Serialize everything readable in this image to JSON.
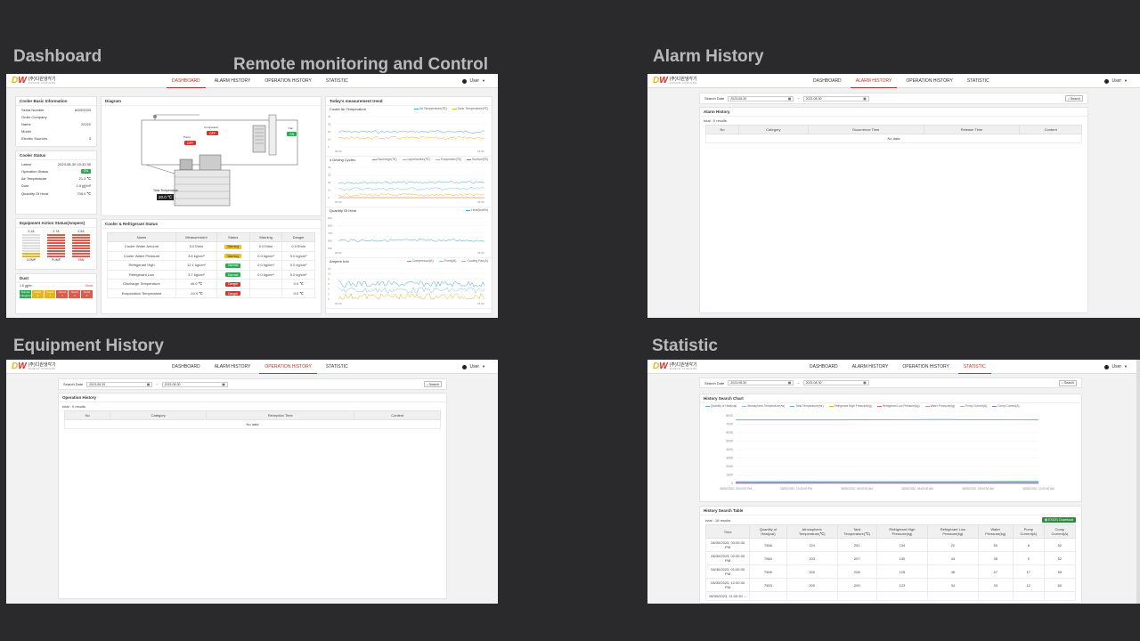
{
  "sections": {
    "dashboard": "Dashboard",
    "remote": "Remote monitoring and Control",
    "alarm": "Alarm History",
    "equipment": "Equipment History",
    "statistic": "Statistic"
  },
  "nav": [
    "DASHBOARD",
    "ALARM HISTORY",
    "OPERATION HISTORY",
    "STATISTIC"
  ],
  "user_label": "User",
  "logo": {
    "mark": "DW",
    "ko": "(주)디원냉각기",
    "en": "DAWON COOLERS"
  },
  "dashboard": {
    "basic_info": {
      "title": "Cooler Basic Information",
      "rows": [
        {
          "label": "Serial Number",
          "value": "A0022033"
        },
        {
          "label": "Order Company",
          "value": ""
        },
        {
          "label": "Name",
          "value": "22222"
        },
        {
          "label": "Model",
          "value": ""
        },
        {
          "label": "Electric Sources",
          "value": "3"
        }
      ]
    },
    "status": {
      "title": "Cooler Status",
      "rows": [
        {
          "label": "Latest",
          "value": "2023-08-30 15:32:30"
        },
        {
          "label": "Operation Status",
          "value": "ON"
        },
        {
          "label": "Air Temperature",
          "value": "21.3 ℃"
        },
        {
          "label": "Dust",
          "value": "1.5 ㎍/m³"
        },
        {
          "label": "Quantity Of Heat",
          "value": "700.0 ℃"
        }
      ]
    },
    "equipment_action": {
      "title": "Equipment Action Status(Ampere)",
      "items": [
        {
          "amp": "0.1A",
          "name": "COMP",
          "level": 0.25,
          "color": "#e8b41c"
        },
        {
          "amp": "2.7A",
          "name": "PUMP",
          "level": 1.0,
          "color": "#e05a4b"
        },
        {
          "amp": "0.9A",
          "name": "FAN",
          "level": 1.0,
          "color": "#e05a4b"
        }
      ]
    },
    "dust": {
      "title": "Dust",
      "value": "1.5 ㎍/m³",
      "label": "Good",
      "levels": [
        {
          "name": "Normal",
          "sub": "1.5ug/m3",
          "color": "#2fa84f"
        },
        {
          "name": "Good",
          "sub": "1",
          "color": "#e8b41c"
        },
        {
          "name": "Good",
          "sub": "1",
          "color": "#e8b41c"
        },
        {
          "name": "Good",
          "sub": "1",
          "color": "#e05a4b"
        },
        {
          "name": "Good",
          "sub": "3",
          "color": "#e05a4b"
        },
        {
          "name": "Good",
          "sub": "4",
          "color": "#e05a4b"
        }
      ]
    },
    "diagram": {
      "title": "Diagram",
      "compressor": "Compressor",
      "compressor_state": "OFF",
      "pump": "Pump",
      "pump_state": "OFF",
      "fan": "Fan",
      "fan_state": "ON",
      "tank_label": "Tank Temperature",
      "tank_value": "20.0 ℃"
    },
    "refrigerant": {
      "title": "Cooler & Refrigerant Status",
      "headers": [
        "Name",
        "Measurement",
        "Status",
        "Warning",
        "Danger"
      ],
      "rows": [
        {
          "name": "Cooler Water Amount",
          "meas": "5.0 ℓ/min",
          "status": "Warning",
          "color": "#f0c419",
          "warn": "0.0 ℓ/min",
          "danger": "0.0 ℓ/min"
        },
        {
          "name": "Cooler Water Pressure",
          "meas": "3.6 kg/cm²",
          "status": "Warning",
          "color": "#f0c419",
          "warn": "0.0 kg/cm²",
          "danger": "0.0 kg/cm²"
        },
        {
          "name": "Refrigerant High",
          "meas": "12.1 kg/cm²",
          "status": "Normal",
          "color": "#2fa84f",
          "warn": "0.0 kg/cm²",
          "danger": "0.0 kg/cm²"
        },
        {
          "name": "Refrigerant Low",
          "meas": "3.7 kg/cm²",
          "status": "Normal",
          "color": "#2fa84f",
          "warn": "0.0 kg/cm²",
          "danger": "0.0 kg/cm²"
        },
        {
          "name": "Discharge Temperature",
          "meas": "40.0 ℃",
          "status": "Danger",
          "color": "#d9342b",
          "warn": "",
          "danger": "0.0 ℃"
        },
        {
          "name": "Evaporation Temperature",
          "meas": "-10.0 ℃",
          "status": "Danger",
          "color": "#d9342b",
          "warn": "",
          "danger": "0.0 ℃"
        }
      ]
    },
    "trend": {
      "title": "Today's measurement trend",
      "charts": [
        {
          "title": "Cooler Air Temperature",
          "legend": [
            {
              "n": "Air Temperature(℃)",
              "c": "#4aa8d8"
            },
            {
              "n": "Tank Temperature(℃)",
              "c": "#e8b41c"
            }
          ],
          "yticks": [
            "40",
            "30",
            "20",
            "10",
            "0"
          ],
          "xticks": [
            "00:00",
            "15:00"
          ]
        },
        {
          "title": "4 Driving Cycles",
          "legend": [
            {
              "n": "Discharge(℃)",
              "c": "#4aa8d8"
            },
            {
              "n": "Liquefaction(℃)",
              "c": "#7ac3e6"
            },
            {
              "n": "Evaporator(℃)",
              "c": "#e8b41c"
            },
            {
              "n": "Suction(℃)",
              "c": "#e05a4b"
            }
          ],
          "yticks": [
            "40",
            "30",
            "20",
            "10",
            "0"
          ],
          "xticks": [
            "00:00",
            "15:00"
          ]
        },
        {
          "title": "Quantity Of Heat",
          "legend": [
            {
              "n": "Heat(kcal/h)",
              "c": "#4aa8d8"
            }
          ],
          "yticks": [
            "900",
            "800",
            "700",
            "600",
            "500"
          ],
          "xticks": [
            "00:00",
            "15:00"
          ]
        },
        {
          "title": "Ampere Info",
          "legend": [
            {
              "n": "Compressor(A)",
              "c": "#4aa8d8"
            },
            {
              "n": "Pump(A)",
              "c": "#7ac3e6"
            },
            {
              "n": "Cooling Fan(A)",
              "c": "#e8b41c"
            }
          ],
          "yticks": [
            "12",
            "10",
            "8",
            "6",
            "4",
            "2",
            "0"
          ],
          "xticks": [
            "00:00",
            "15:00"
          ]
        }
      ]
    }
  },
  "alarm": {
    "search_label": "Search Date",
    "from": "2023-08-30",
    "to": "2023-08-30",
    "search_btn": "Search",
    "list_title": "Alarm History",
    "total": "total : 0 results",
    "headers": [
      "No",
      "Category",
      "Occurrence Time",
      "Release Time",
      "Content"
    ],
    "empty": "No data"
  },
  "equipment": {
    "search_label": "Search Date",
    "from": "2023-08-30",
    "to": "2023-08-30",
    "search_btn": "Search",
    "list_title": "Operation History",
    "total": "total : 0 results",
    "headers": [
      "No",
      "Category",
      "Reception Time",
      "Content"
    ],
    "empty": "No data"
  },
  "statistic": {
    "search_label": "Search Date",
    "from": "2023-08-30",
    "to": "2023-08-30",
    "search_btn": "Search",
    "chart_title": "History Search Chart",
    "legend": [
      {
        "n": "Quantity of Heat(cal)",
        "c": "#4aa8d8"
      },
      {
        "n": "Atmospheric Temperature(℃)",
        "c": "#7ac3e6"
      },
      {
        "n": "Tank Temperature(℃)",
        "c": "#55b7a5"
      },
      {
        "n": "Refrigerant High Pressure(kg)",
        "c": "#e8b41c"
      },
      {
        "n": "Refrigerant Low Pressure(kg)",
        "c": "#e05a4b"
      },
      {
        "n": "Water Pressure(kg)",
        "c": "#e07aa8"
      },
      {
        "n": "Pump Current(A)",
        "c": "#aaaaaa"
      },
      {
        "n": "Comp Current(A)",
        "c": "#8e6fc1"
      }
    ],
    "yticks": [
      "8000",
      "7000",
      "6000",
      "5000",
      "4000",
      "3000",
      "2000",
      "1000",
      "0"
    ],
    "xticks": [
      "08/30/2022, 03:00:00 PM",
      "08/30/2022, 12:00:00 PM",
      "08/30/2022, 09:00:00 AM",
      "08/30/2022, 06:00:00 AM",
      "08/30/2022, 03:00:00 AM",
      "08/30/2022, 12:00:00 AM"
    ],
    "table_title": "History Search Table",
    "total": "total : 16 results",
    "excel": "EXCEL Download",
    "headers": [
      "Time",
      "Quantity of Heat(cal)",
      "Atmospheric Temperature(℃)",
      "Tank Temperature(℃)",
      "Refrigerant High Pressure(kg)",
      "Refrigerant Low Pressure(kg)",
      "Water Pressure(kg)",
      "Pump Current(A)",
      "Comp Current(A)"
    ],
    "rows": [
      [
        "08/30/2023, 03:00:30 PM",
        "7508",
        "224",
        "252",
        "134",
        "22",
        "50",
        "8",
        "52"
      ],
      [
        "08/30/2023, 02:00:30 PM",
        "7560",
        "203",
        "207",
        "130",
        "43",
        "35",
        "9",
        "52"
      ],
      [
        "08/30/2023, 01:00:30 PM",
        "7506",
        "200",
        "208",
        "125",
        "46",
        "47",
        "17",
        "55"
      ],
      [
        "08/30/2023, 12:00:30 PM",
        "7503",
        "200",
        "200",
        "123",
        "34",
        "33",
        "12",
        "60"
      ],
      [
        "08/30/2023, 11:00:30 ...",
        "",
        "",
        "",
        "",
        "",
        "",
        "",
        ""
      ]
    ]
  },
  "chart_data": {
    "type": "line",
    "title": "History Search Chart",
    "ylim": [
      0,
      8000
    ],
    "series": [
      {
        "name": "Quantity of Heat(cal)",
        "values": [
          7508,
          7560,
          7506,
          7503
        ]
      },
      {
        "name": "Atmospheric Temperature(℃)",
        "values": [
          224,
          203,
          200,
          200
        ]
      },
      {
        "name": "Tank Temperature(℃)",
        "values": [
          252,
          207,
          208,
          200
        ]
      },
      {
        "name": "Refrigerant High Pressure(kg)",
        "values": [
          134,
          130,
          125,
          123
        ]
      },
      {
        "name": "Refrigerant Low Pressure(kg)",
        "values": [
          22,
          43,
          46,
          34
        ]
      },
      {
        "name": "Water Pressure(kg)",
        "values": [
          50,
          35,
          47,
          33
        ]
      },
      {
        "name": "Pump Current(A)",
        "values": [
          8,
          9,
          17,
          12
        ]
      },
      {
        "name": "Comp Current(A)",
        "values": [
          52,
          52,
          55,
          60
        ]
      }
    ],
    "categories": [
      "08/30/2023, 03:00:30 PM",
      "08/30/2023, 02:00:30 PM",
      "08/30/2023, 01:00:30 PM",
      "08/30/2023, 12:00:30 PM"
    ]
  }
}
